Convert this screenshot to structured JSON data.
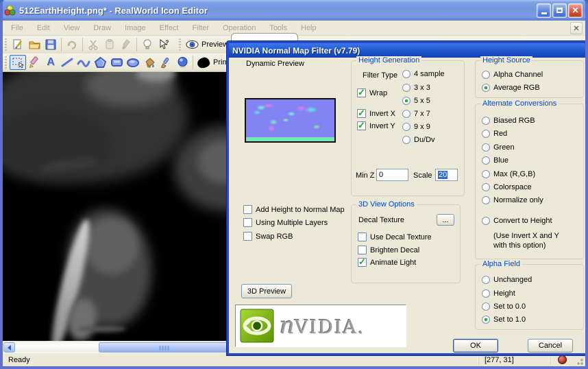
{
  "window": {
    "title": "512EarthHeight.png* - RealWorld Icon Editor"
  },
  "menu": {
    "items": [
      "File",
      "Edit",
      "View",
      "Draw",
      "Image",
      "Effect",
      "Filter",
      "Operation",
      "Tools",
      "Help"
    ]
  },
  "toolbar": {
    "preview_label": "Preview",
    "primary_label": "Prim",
    "text_tool_glyph": "A"
  },
  "icons": {
    "close_glyph": "✕",
    "mdi_close_glyph": "✕",
    "check_glyph": "✓",
    "help_glyph": "?"
  },
  "statusbar": {
    "ready": "Ready",
    "coords": "[277, 31]"
  },
  "dialog": {
    "title": "NVIDIA Normal Map Filter (v7.79)",
    "dynamic_preview": "Dynamic Preview",
    "height_generation": {
      "caption": "Height Generation",
      "filter_type_label": "Filter Type",
      "radios": [
        "4 sample",
        "3 x 3",
        "5 x 5",
        "7 x 7",
        "9 x 9",
        "Du/Dv"
      ],
      "selected": "5 x 5",
      "wrap": "Wrap",
      "invert_x": "Invert X",
      "invert_y": "Invert Y",
      "min_z_label": "Min Z",
      "min_z_value": "0",
      "scale_label": "Scale",
      "scale_value": "20"
    },
    "height_source": {
      "caption": "Height Source",
      "radios": [
        "Alpha Channel",
        "Average RGB"
      ],
      "selected": "Average RGB"
    },
    "alternate_conversions": {
      "caption": "Alternate Conversions",
      "radios": [
        "Biased RGB",
        "Red",
        "Green",
        "Blue",
        "Max (R,G,B)",
        "Colorspace",
        "Normalize only",
        "Convert to Height"
      ],
      "note_line1": "(Use Invert X and Y",
      "note_line2": "with this option)"
    },
    "options": {
      "add_height": "Add Height to Normal Map",
      "multiple_layers": "Using Multiple Layers",
      "swap_rgb": "Swap RGB"
    },
    "view3d": {
      "caption": "3D View Options",
      "decal_texture_label": "Decal Texture",
      "browse_label": "...",
      "use_decal": "Use Decal Texture",
      "brighten": "Brighten Decal",
      "animate": "Animate Light"
    },
    "alpha_field": {
      "caption": "Alpha Field",
      "radios": [
        "Unchanged",
        "Height",
        "Set to 0.0",
        "Set to 1.0"
      ],
      "selected": "Set to 1.0"
    },
    "preview3d_button": "3D Preview",
    "nvidia_n": "n",
    "nvidia_rest": "VIDIA.",
    "ok": "OK",
    "cancel": "Cancel"
  }
}
